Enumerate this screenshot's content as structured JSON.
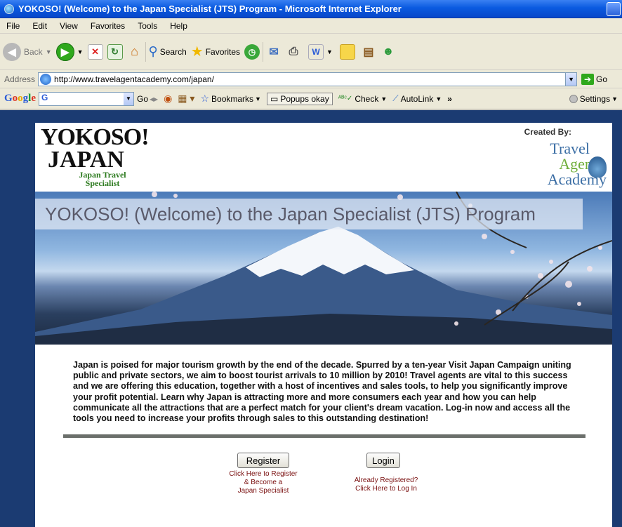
{
  "browser": {
    "title": "YOKOSO! (Welcome) to the Japan Specialist (JTS) Program - Microsoft Internet Explorer",
    "menu": [
      "File",
      "Edit",
      "View",
      "Favorites",
      "Tools",
      "Help"
    ],
    "toolbar": {
      "back_label": "Back",
      "search_label": "Search",
      "favorites_label": "Favorites"
    },
    "address": {
      "label": "Address",
      "url": "http://www.travelagentacademy.com/japan/",
      "go_label": "Go"
    },
    "google_bar": {
      "logo": "Google",
      "search_value": "G",
      "go_label": "Go",
      "bookmarks_label": "Bookmarks",
      "popups_label": "Popups okay",
      "check_label": "Check",
      "autolink_label": "AutoLink",
      "more_label": "»",
      "settings_label": "Settings"
    }
  },
  "page": {
    "logo": {
      "yokoso": "YOKOSO!",
      "japan": "JAPAN",
      "subtitle_line1": "Japan Travel",
      "subtitle_line2": "Specialist"
    },
    "created_by": "Created By:",
    "taa_logo": {
      "line1": "Travel",
      "line2": "Agent",
      "line3": "Academy"
    },
    "hero_title": "YOKOSO! (Welcome) to the Japan Specialist (JTS) Program",
    "intro": "Japan is poised for major tourism growth by the end of the decade. Spurred by a ten-year Visit Japan Campaign uniting public and private sectors, we aim to boost tourist arrivals to 10 million by 2010! Travel agents are vital to this success and we are offering this education, together with a host of incentives and sales tools, to help you significantly improve your profit potential. Learn why Japan is attracting more and more consumers each year and how you can help communicate all the attractions that are a perfect match for your client's dream vacation.  Log-in now and access all the tools you need to increase your profits through sales to this outstanding destination!",
    "register": {
      "button": "Register",
      "hint_line1": "Click Here to Register",
      "hint_line2": "& Become a",
      "hint_line3": "Japan Specialist"
    },
    "login": {
      "button": "Login",
      "hint_line1": "Already Registered?",
      "hint_line2": "Click Here to Log In"
    }
  },
  "colors": {
    "page_background": "#1b3b72",
    "hint_text": "#7a1010",
    "rule": "#6b6f6b",
    "logo_red": "#d21e1e",
    "logo_green": "#2c7a1e"
  }
}
